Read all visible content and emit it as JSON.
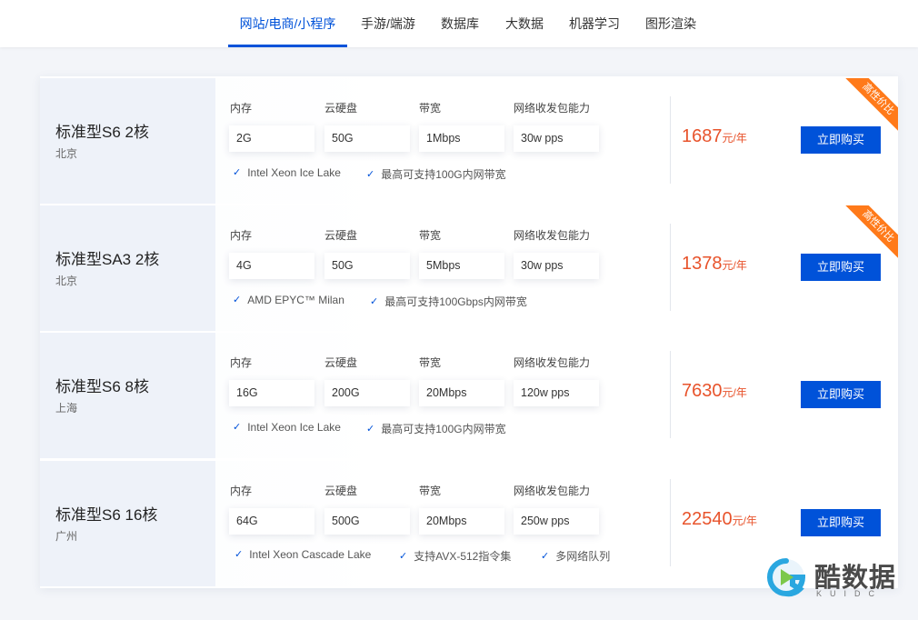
{
  "tabs": [
    {
      "label": "网站/电商/小程序",
      "active": true
    },
    {
      "label": "手游/端游",
      "active": false
    },
    {
      "label": "数据库",
      "active": false
    },
    {
      "label": "大数据",
      "active": false
    },
    {
      "label": "机器学习",
      "active": false
    },
    {
      "label": "图形渲染",
      "active": false
    }
  ],
  "spec_labels": {
    "memory": "内存",
    "disk": "云硬盘",
    "bandwidth": "带宽",
    "pps": "网络收发包能力"
  },
  "price_unit": "元/年",
  "buy_label": "立即购买",
  "ribbon_label": "高性价比",
  "products": [
    {
      "name": "标准型S6 2核",
      "region": "北京",
      "memory": "2G",
      "disk": "50G",
      "bandwidth": "1Mbps",
      "pps": "30w pps",
      "features": [
        "Intel Xeon Ice Lake",
        "最高可支持100G内网带宽"
      ],
      "price": "1687",
      "ribbon": true
    },
    {
      "name": "标准型SA3 2核",
      "region": "北京",
      "memory": "4G",
      "disk": "50G",
      "bandwidth": "5Mbps",
      "pps": "30w pps",
      "features": [
        "AMD EPYC™ Milan",
        "最高可支持100Gbps内网带宽"
      ],
      "price": "1378",
      "ribbon": true
    },
    {
      "name": "标准型S6 8核",
      "region": "上海",
      "memory": "16G",
      "disk": "200G",
      "bandwidth": "20Mbps",
      "pps": "120w pps",
      "features": [
        "Intel Xeon Ice Lake",
        "最高可支持100G内网带宽"
      ],
      "price": "7630",
      "ribbon": false
    },
    {
      "name": "标准型S6 16核",
      "region": "广州",
      "memory": "64G",
      "disk": "500G",
      "bandwidth": "20Mbps",
      "pps": "250w pps",
      "features": [
        "Intel Xeon Cascade Lake",
        "支持AVX-512指令集",
        "多网络队列"
      ],
      "price": "22540",
      "ribbon": false
    }
  ],
  "watermark": {
    "text": "酷数据",
    "sub": "KUIDC"
  },
  "colors": {
    "accent": "#0052d9",
    "price": "#e8532b",
    "ribbon": "#ff7a1a"
  }
}
